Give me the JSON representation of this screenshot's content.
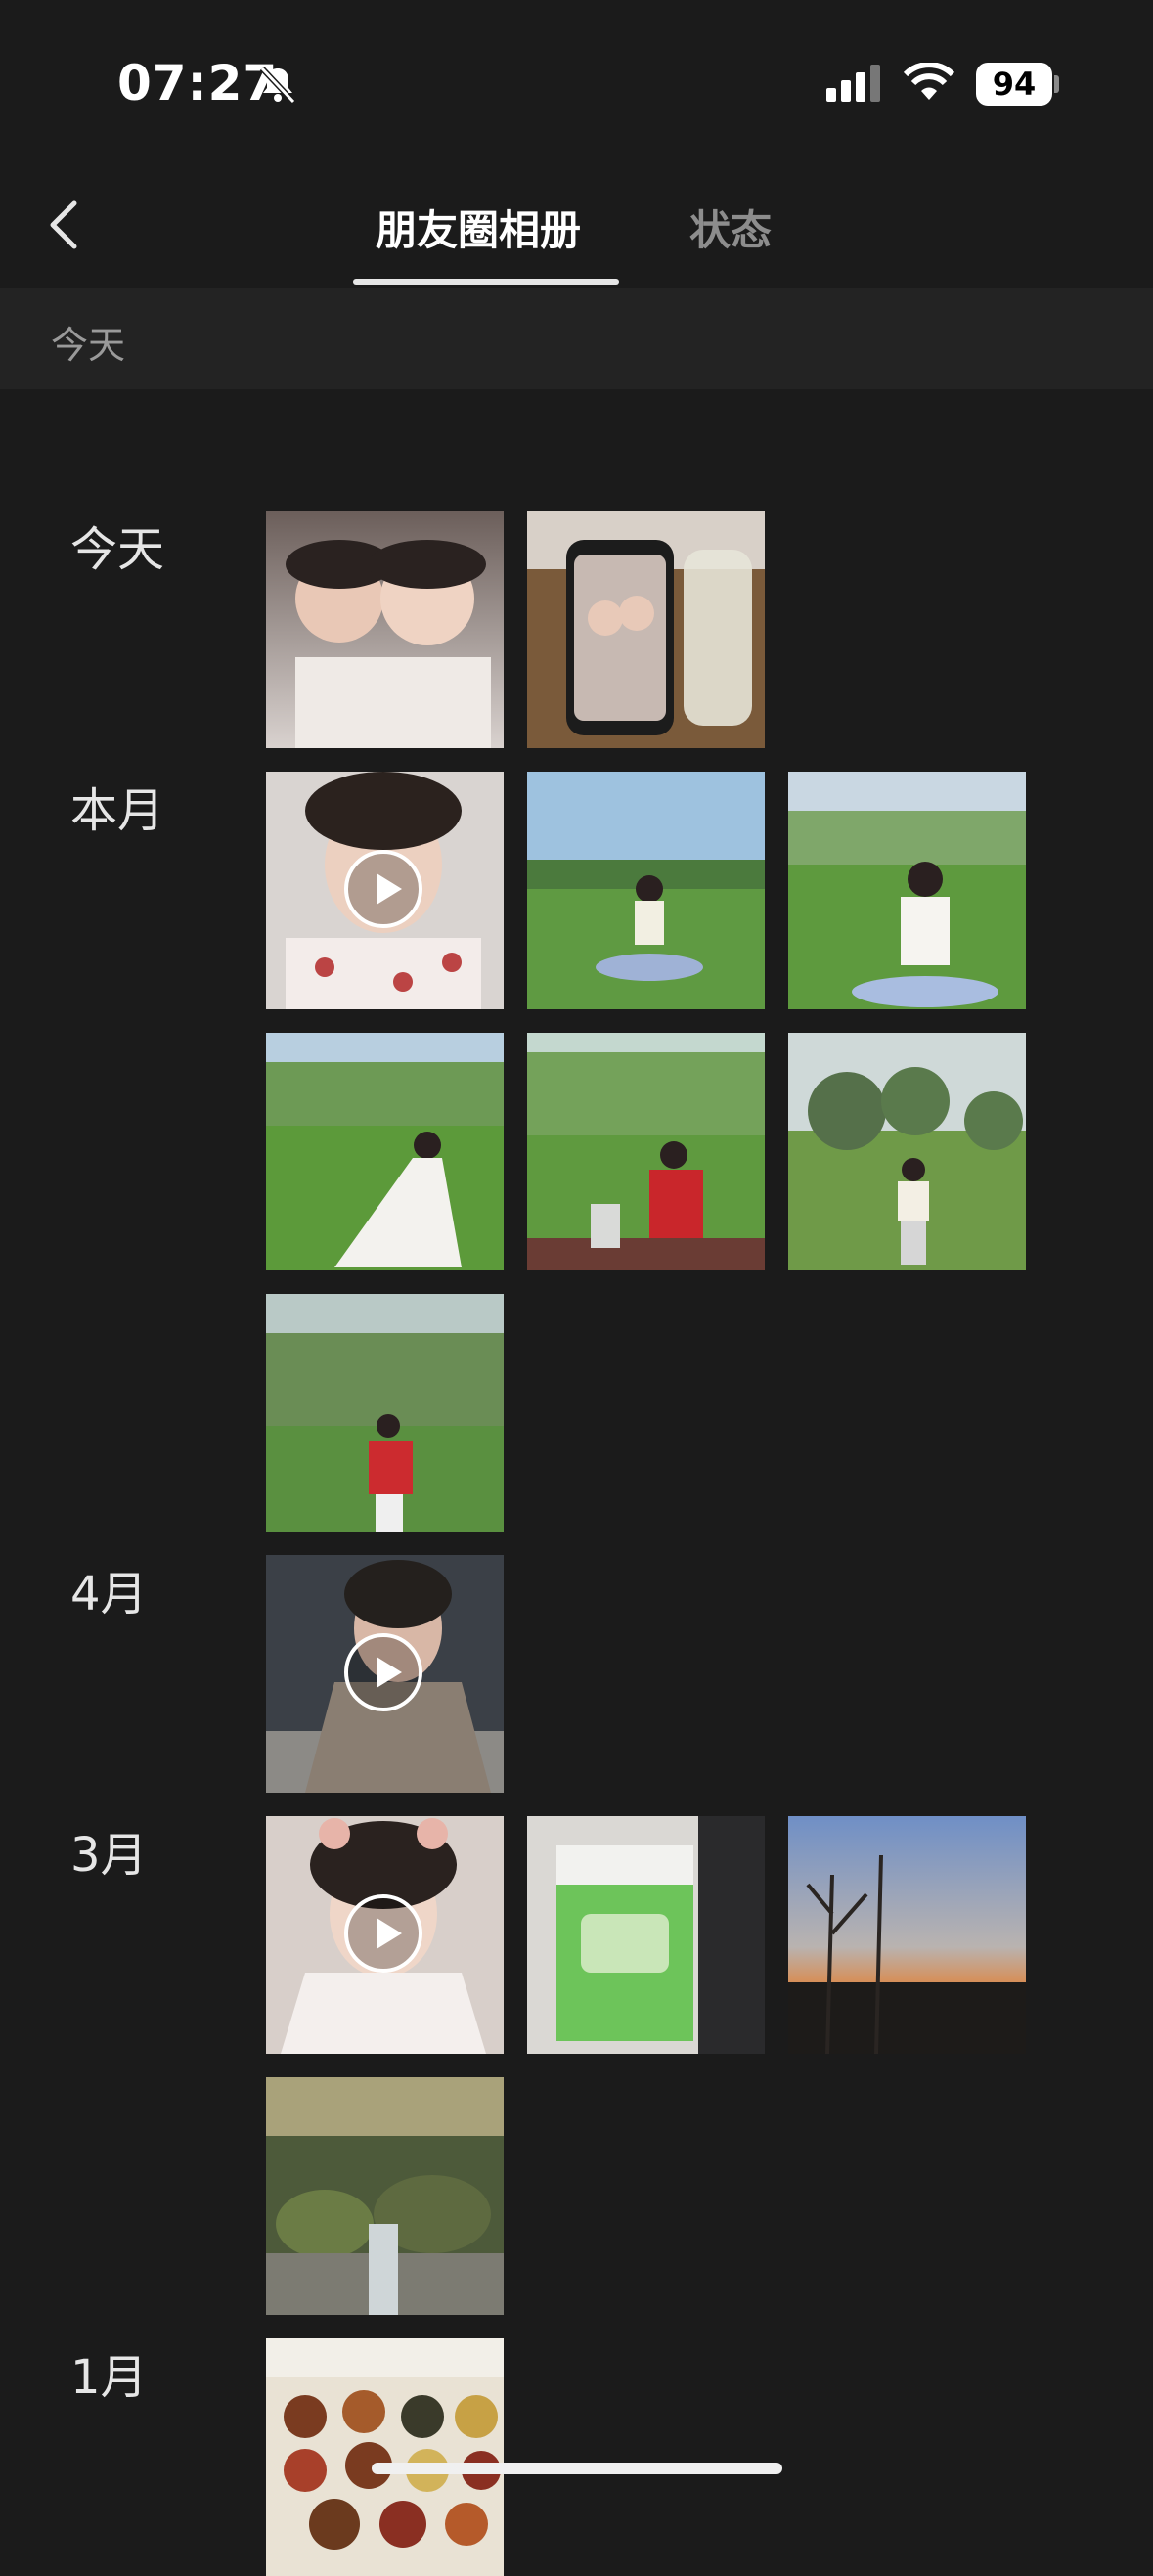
{
  "status_bar": {
    "time": "07:27",
    "battery": "94"
  },
  "nav": {
    "tabs": [
      {
        "label": "朋友圈相册"
      },
      {
        "label": "状态"
      }
    ]
  },
  "section_header": "今天",
  "groups": [
    {
      "label": "今天"
    },
    {
      "label": "本月"
    },
    {
      "label": "4月"
    },
    {
      "label": "3月"
    },
    {
      "label": "1月"
    }
  ],
  "colors": {
    "background": "#1b1b1b",
    "header_bar": "#232323",
    "active_tab": "#ffffff",
    "inactive_tab": "#8d8d8d"
  },
  "icons": [
    "chevron-left-icon",
    "bell-slash-icon",
    "cellular-signal-icon",
    "wifi-icon",
    "battery-icon",
    "play-icon"
  ]
}
